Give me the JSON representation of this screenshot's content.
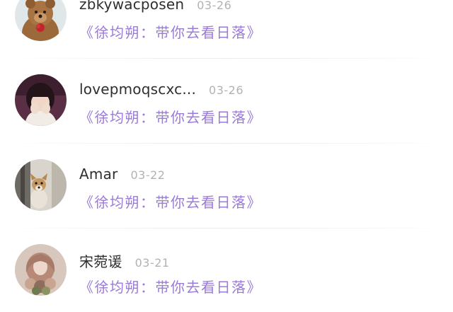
{
  "comments": [
    {
      "username": "zbkywacposen",
      "date": "03-26",
      "song_title": "《徐均朔：带你去看日落》",
      "avatar_icon": "teddy-bear-avatar"
    },
    {
      "username": "lovepmoqscxc...",
      "date": "03-26",
      "song_title": "《徐均朔：带你去看日落》",
      "avatar_icon": "girl-covering-face-avatar"
    },
    {
      "username": "Amar",
      "date": "03-22",
      "song_title": "《徐均朔：带你去看日落》",
      "avatar_icon": "small-dog-avatar"
    },
    {
      "username": "宋菀谖",
      "date": "03-21",
      "song_title": "《徐均朔：带你去看日落》",
      "avatar_icon": "woman-with-flowers-avatar"
    }
  ],
  "colors": {
    "song_accent": "#9b7bd8",
    "username": "#2f2f2f",
    "date": "#b2b2b2"
  }
}
